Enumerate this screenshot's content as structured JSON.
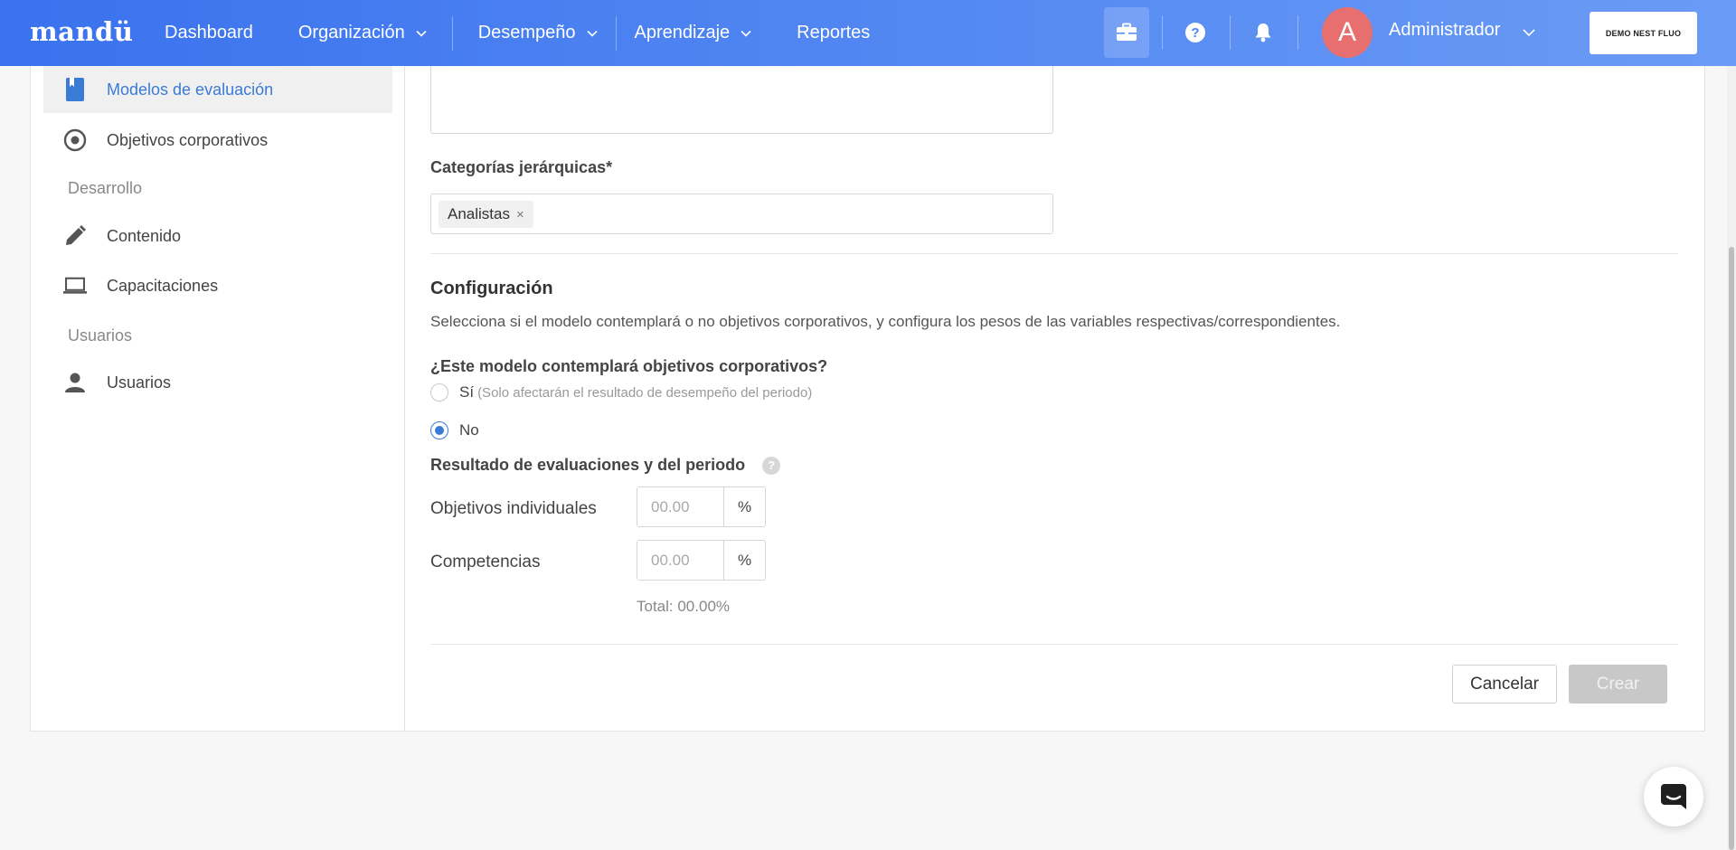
{
  "brand": {
    "logo": "mandü"
  },
  "nav": {
    "items": [
      {
        "label": "Dashboard"
      },
      {
        "label": "Organización"
      },
      {
        "label": "Desempeño"
      },
      {
        "label": "Aprendizaje"
      },
      {
        "label": "Reportes"
      }
    ]
  },
  "topbar": {
    "avatar_initial": "A",
    "user_name": "Administrador",
    "demo_button": "DEMO NEST FLUO"
  },
  "sidebar": {
    "items": [
      {
        "label": "Modelos de evaluación",
        "icon": "book-icon"
      },
      {
        "label": "Objetivos corporativos",
        "icon": "target-icon"
      },
      {
        "label": "Contenido",
        "icon": "pencil-icon"
      },
      {
        "label": "Capacitaciones",
        "icon": "laptop-icon"
      },
      {
        "label": "Usuarios",
        "icon": "person-icon"
      }
    ],
    "sections": [
      {
        "label": "Desarrollo"
      },
      {
        "label": "Usuarios"
      }
    ]
  },
  "form": {
    "categories_label": "Categorías jerárquicas*",
    "categories_tags": [
      {
        "label": "Analistas",
        "remove": "×"
      }
    ],
    "config_title": "Configuración",
    "config_desc": "Selecciona si el modelo contemplará o no objetivos corporativos, y configura los pesos de las variables respectivas/correspondientes.",
    "question": "¿Este modelo contemplará objetivos corporativos?",
    "option_yes": "Sí",
    "option_yes_hint": "(Solo afectarán el resultado de desempeño del periodo)",
    "option_no": "No",
    "selected_option": "No",
    "results_title": "Resultado de evaluaciones y del periodo",
    "help_symbol": "?",
    "fields": [
      {
        "label": "Objetivos individuales",
        "placeholder": "00.00",
        "suffix": "%"
      },
      {
        "label": "Competencias",
        "placeholder": "00.00",
        "suffix": "%"
      }
    ],
    "total": "Total: 00.00%",
    "cancel_label": "Cancelar",
    "create_label": "Crear"
  },
  "colors": {
    "accent": "#3a7bd5",
    "topbar_start": "#3a72ee",
    "topbar_end": "#6a9bf5",
    "avatar_bg": "#e86f6f",
    "disabled_button": "#c8c8c8"
  }
}
